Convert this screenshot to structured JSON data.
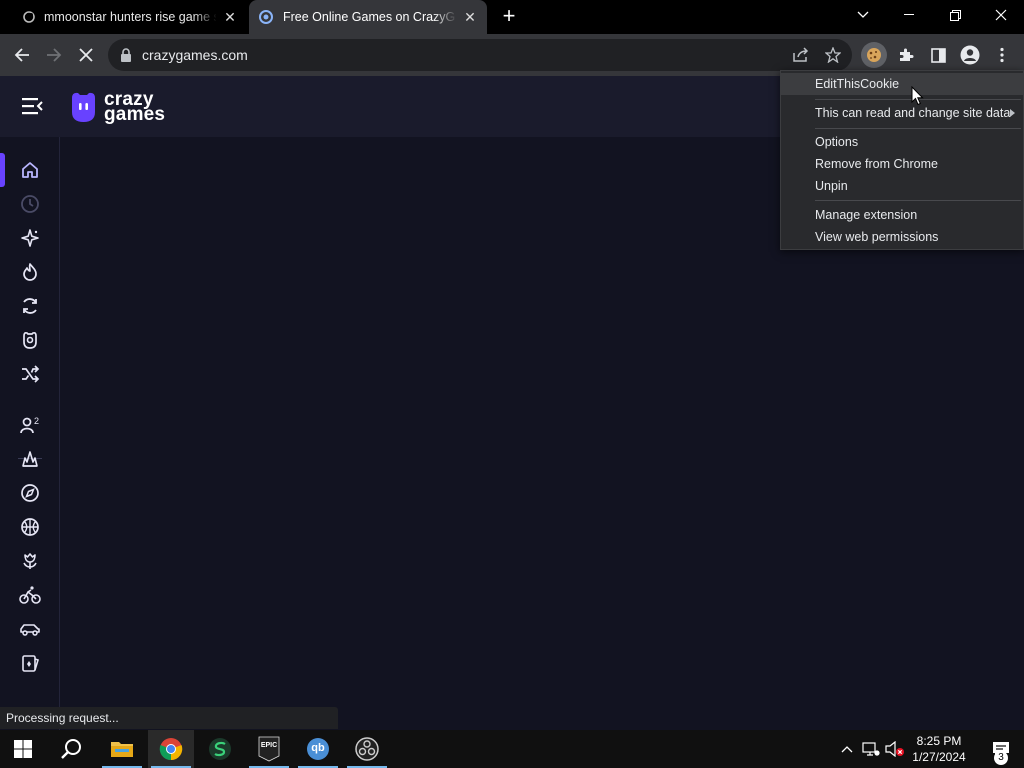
{
  "browser": {
    "tabs": [
      {
        "title": "mmoonstar hunters rise game si",
        "favicon": "game-site-icon",
        "active": false
      },
      {
        "title": "Free Online Games on CrazyGam",
        "favicon": "crazygames-icon",
        "active": true
      }
    ],
    "url": "crazygames.com",
    "status_text": "Processing request..."
  },
  "context_menu": {
    "items": [
      {
        "label": "EditThisCookie",
        "highlighted": true
      },
      {
        "label": "This can read and change site data",
        "submenu": true
      },
      {
        "label": "Options"
      },
      {
        "label": "Remove from Chrome"
      },
      {
        "label": "Unpin"
      },
      {
        "label": "Manage extension"
      },
      {
        "label": "View web permissions"
      }
    ]
  },
  "site": {
    "logo_line1": "crazy",
    "logo_line2": "games",
    "sidebar_icons": [
      "home-icon",
      "recent-icon",
      "new-icon",
      "trending-icon",
      "updated-icon",
      "originals-icon",
      "random-icon",
      "multiplayer-icon",
      "action-icon",
      "adventure-icon",
      "basketball-icon",
      "beauty-icon",
      "bike-icon",
      "car-icon",
      "card-icon"
    ],
    "accent_color": "#6842ff"
  },
  "taskbar": {
    "apps": [
      "windows-start-icon",
      "search-icon",
      "file-explorer-icon",
      "chrome-icon",
      "app-s-icon",
      "epic-games-icon",
      "qbittorrent-icon",
      "obs-icon"
    ],
    "epic_label": "EPIC",
    "qb_label": "qb",
    "time": "8:25 PM",
    "date": "1/27/2024",
    "notification_count": "3"
  }
}
